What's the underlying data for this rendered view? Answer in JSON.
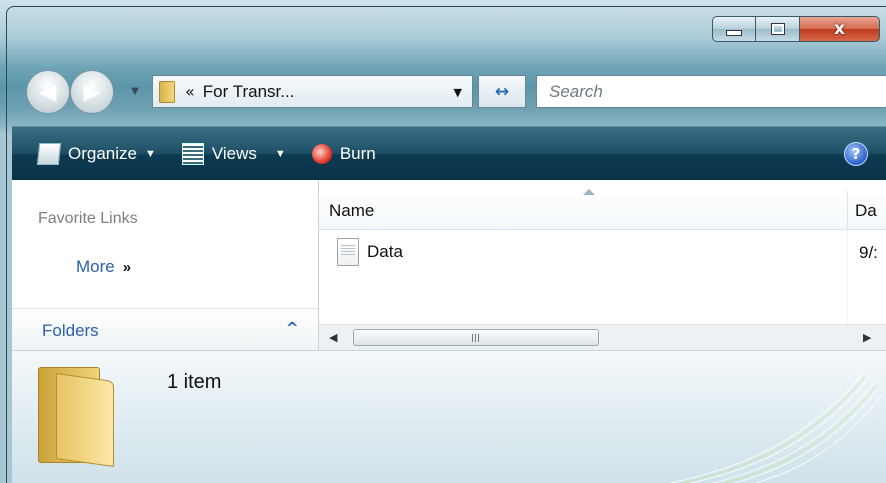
{
  "window": {
    "caption": {
      "minimize_icon": "minimize-icon",
      "maximize_icon": "maximize-icon",
      "close_label": "x"
    }
  },
  "navigation": {
    "back_icon": "back-arrow-icon",
    "forward_icon": "forward-arrow-icon",
    "address": {
      "chevron": "«",
      "text": "For Transr..."
    },
    "refresh_glyph": "↔",
    "search": {
      "placeholder": "Search"
    }
  },
  "toolbar": {
    "organize_label": "Organize",
    "views_label": "Views",
    "burn_label": "Burn",
    "help_label": "?"
  },
  "left_pane": {
    "favorite_links_title": "Favorite Links",
    "more_label": "More",
    "more_chevron": "»",
    "folders_label": "Folders",
    "folders_chevron": "^"
  },
  "file_list": {
    "columns": {
      "name": "Name",
      "date": "Da"
    },
    "rows": [
      {
        "name": "Data",
        "date": "9/:"
      }
    ],
    "scroll_grip": "III"
  },
  "details_pane": {
    "item_count": "1 item"
  },
  "colors": {
    "command_bar": "#1e4f66",
    "link_blue": "#2b5fb0",
    "close_red": "#c8462a"
  }
}
